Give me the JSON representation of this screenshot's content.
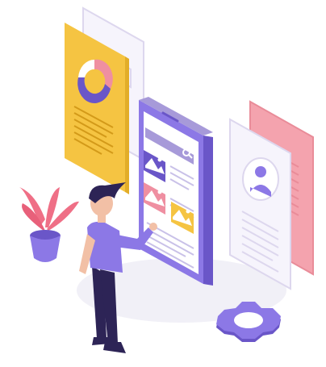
{
  "illustration": {
    "subject": "person-tapping-phone-with-floating-ui-panels",
    "icons": [
      "donut-chart-icon",
      "search-icon",
      "image-icon",
      "user-icon",
      "gear-icon",
      "plant-icon"
    ]
  },
  "colors": {
    "background": "#ffffff",
    "shadow": "#f1f0f7",
    "phone_body": "#8c78e6",
    "phone_side": "#6a56c8",
    "phone_screen": "#ffffff",
    "search_bar": "#a79ad9",
    "image_card_purple": "#6a56c8",
    "image_card_pink": "#ef8fa1",
    "image_card_yellow": "#f5c442",
    "yellow_panel": "#f5c442",
    "yellow_panel_side": "#e2ad28",
    "white_panel": "#f6f4fc",
    "white_panel_border": "#ddd7ee",
    "pink_panel": "#f4a3ae",
    "pink_panel_border": "#e98c99",
    "donut_purple": "#6a56c8",
    "donut_pink": "#ef8fa1",
    "donut_light": "#ffffff",
    "gear": "#8c78e6",
    "gear_side": "#6a56c8",
    "plant_leaf": "#ef6f86",
    "pot": "#6a56c8",
    "shirt": "#8c78e6",
    "pants": "#2d2456",
    "hair": "#2d2456",
    "skin": "#f2c0a6",
    "text_line": "#c9c1e8"
  }
}
